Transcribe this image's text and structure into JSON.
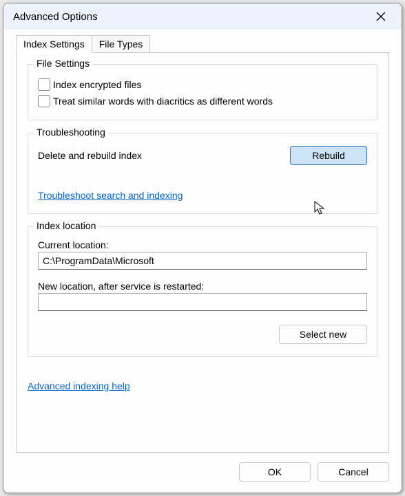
{
  "title": "Advanced Options",
  "tabs": {
    "index_settings": "Index Settings",
    "file_types": "File Types"
  },
  "file_settings": {
    "legend": "File Settings",
    "index_encrypted": "Index encrypted files",
    "treat_diacritics": "Treat similar words with diacritics as different words"
  },
  "troubleshooting": {
    "legend": "Troubleshooting",
    "delete_rebuild": "Delete and rebuild index",
    "rebuild_button": "Rebuild",
    "troubleshoot_link": "Troubleshoot search and indexing"
  },
  "index_location": {
    "legend": "Index location",
    "current_label": "Current location:",
    "current_value": "C:\\ProgramData\\Microsoft",
    "new_label": "New location, after service is restarted:",
    "new_value": "",
    "select_new": "Select new"
  },
  "help_link": "Advanced indexing help",
  "buttons": {
    "ok": "OK",
    "cancel": "Cancel"
  }
}
